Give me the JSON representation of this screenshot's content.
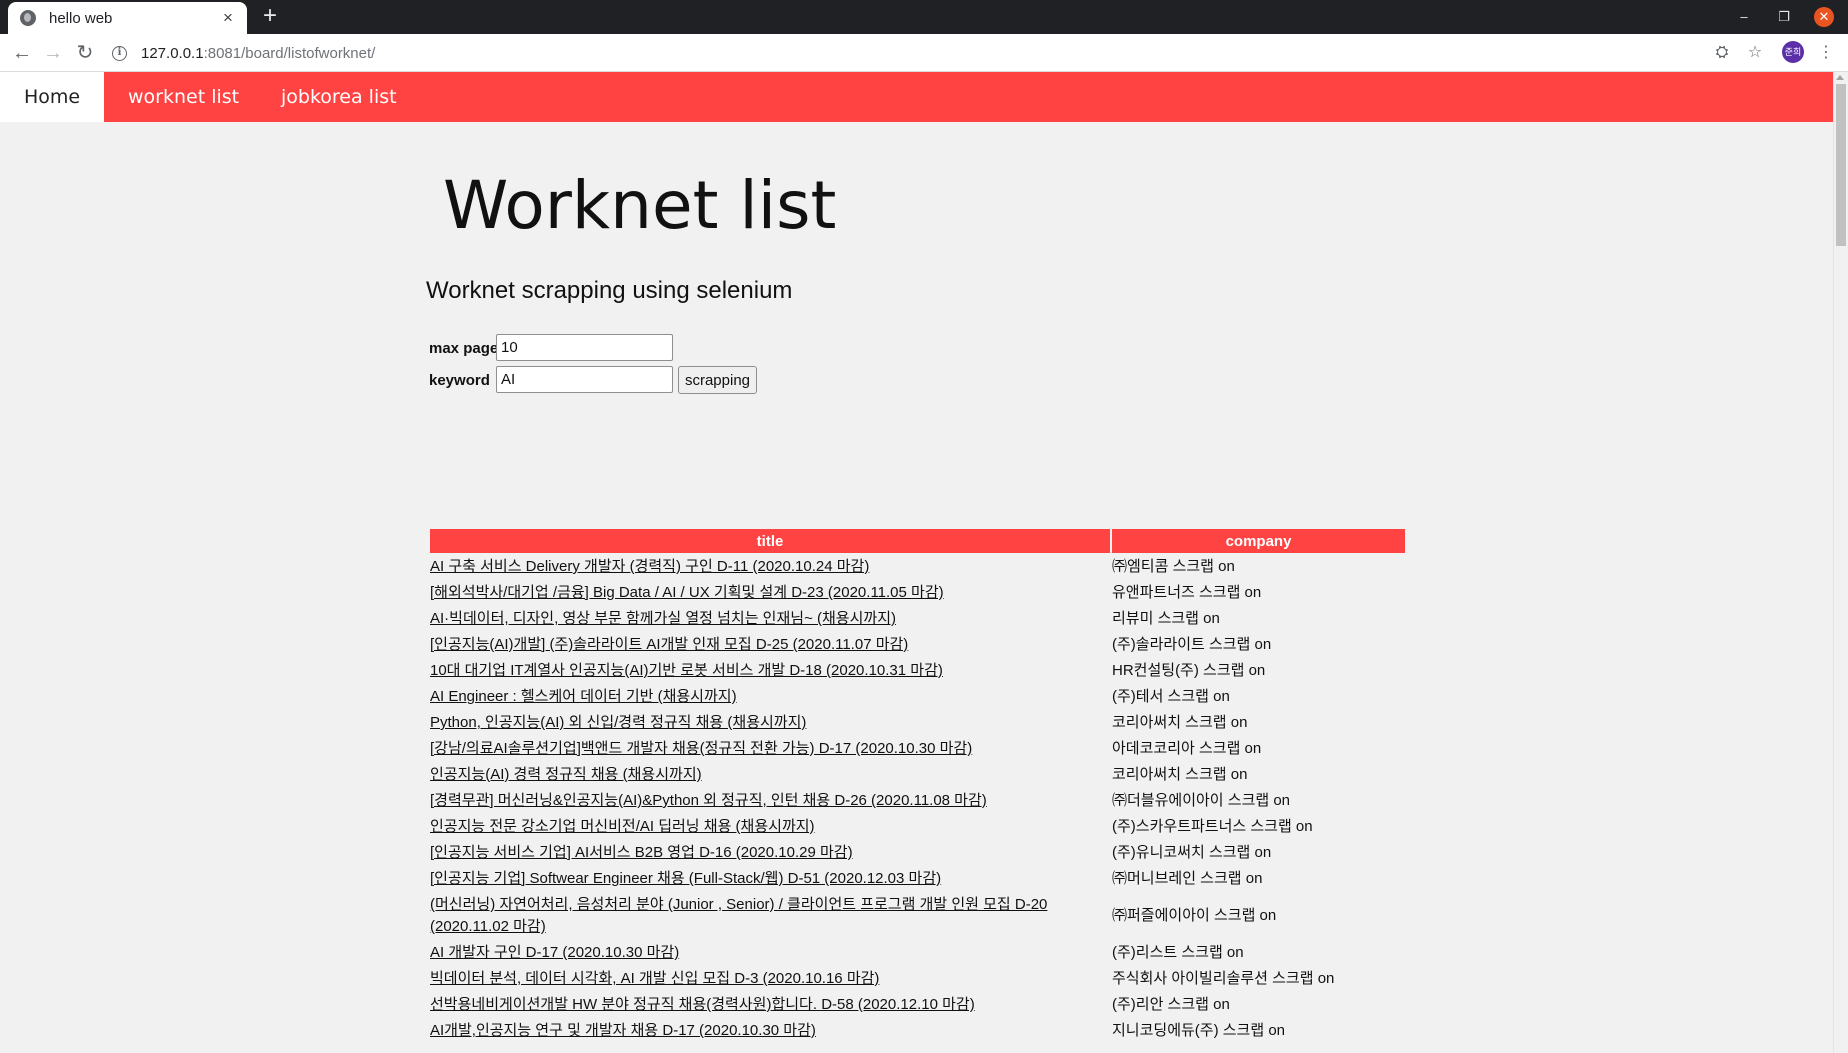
{
  "browser": {
    "tab_title": "hello web",
    "url_host": "127.0.0.1",
    "url_rest": ":8081/board/listofworknet/",
    "avatar_text": "준희"
  },
  "navbar": {
    "items": [
      {
        "label": "Home",
        "active": true
      },
      {
        "label": "worknet list",
        "active": false
      },
      {
        "label": "jobkorea list",
        "active": false
      }
    ],
    "color": "#ff4242"
  },
  "page": {
    "title": "Worknet list",
    "subtitle": "Worknet scrapping using selenium"
  },
  "form": {
    "max_page_label": "max page",
    "max_page_value": "10",
    "keyword_label": "keyword",
    "keyword_value": "AI",
    "submit_label": "scrapping"
  },
  "table": {
    "headers": {
      "title": "title",
      "company": "company"
    },
    "rows": [
      {
        "title": "AI 구축 서비스 Delivery 개발자 (경력직) 구인 D-11 (2020.10.24 마감)",
        "company": "㈜엠티콤 스크랩 on"
      },
      {
        "title": "[해외석박사/대기업 /금융] Big Data / AI / UX 기획및 설계 D-23 (2020.11.05 마감)",
        "company": "유앤파트너즈 스크랩 on"
      },
      {
        "title": "AI·빅데이터, 디자인, 영상 부문 함께가실 열정 넘치는 인재님~ (채용시까지)",
        "company": "리뷰미 스크랩 on"
      },
      {
        "title": "[인공지능(AI)개발] (주)솔라라이트 AI개발 인재 모집 D-25 (2020.11.07 마감)",
        "company": "(주)솔라라이트 스크랩 on"
      },
      {
        "title": "10대 대기업 IT계열사 인공지능(AI)기반 로봇 서비스 개발 D-18 (2020.10.31 마감)",
        "company": "HR컨설팅(주) 스크랩 on"
      },
      {
        "title": "AI Engineer : 헬스케어 데이터 기반 (채용시까지)",
        "company": "(주)테서 스크랩 on"
      },
      {
        "title": "Python, 인공지능(AI) 외 신입/경력 정규직 채용 (채용시까지)",
        "company": "코리아써치 스크랩 on"
      },
      {
        "title": "[강남/의료AI솔루션기업]백앤드 개발자 채용(정규직 전환 가능) D-17 (2020.10.30 마감)",
        "company": "아데코코리아 스크랩 on"
      },
      {
        "title": "인공지능(AI) 경력 정규직 채용 (채용시까지)",
        "company": "코리아써치 스크랩 on"
      },
      {
        "title": "[경력무관] 머신러닝&인공지능(AI)&Python 외 정규직, 인턴 채용 D-26 (2020.11.08 마감)",
        "company": "㈜더블유에이아이 스크랩 on"
      },
      {
        "title": "인공지능 전문 강소기업 머신비전/AI 딥러닝 채용 (채용시까지)",
        "company": "(주)스카우트파트너스 스크랩 on"
      },
      {
        "title": "[인공지능 서비스 기업] AI서비스 B2B 영업 D-16 (2020.10.29 마감)",
        "company": "(주)유니코써치 스크랩 on"
      },
      {
        "title": "[인공지능 기업] Softwear Engineer 채용 (Full-Stack/웹) D-51 (2020.12.03 마감)",
        "company": "㈜머니브레인 스크랩 on"
      },
      {
        "title": "(머신러닝) 자연어처리, 음성처리 분야 (Junior , Senior) / 클라이언트 프로그램 개발 인원 모집 D-20 (2020.11.02 마감)",
        "company": "㈜퍼즐에이아이 스크랩 on"
      },
      {
        "title": "AI 개발자 구인 D-17 (2020.10.30 마감)",
        "company": "(주)리스트 스크랩 on"
      },
      {
        "title": "빅데이터 분석, 데이터 시각화, AI 개발 신입 모집 D-3 (2020.10.16 마감)",
        "company": "주식회사 아이빌리솔루션 스크랩 on"
      },
      {
        "title": "선박용네비게이션개발 HW 분야 정규직 채용(경력사원)합니다. D-58 (2020.12.10 마감)",
        "company": "(주)리안 스크랩 on"
      },
      {
        "title": "AI개발,인공지능 연구 및 개발자 채용 D-17 (2020.10.30 마감)",
        "company": "지니코딩에듀(주) 스크랩 on"
      }
    ]
  }
}
